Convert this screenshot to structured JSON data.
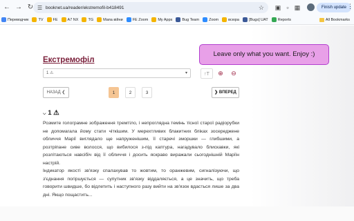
{
  "browser": {
    "url": "booknet.ua/reader/ekstremofil-b418491",
    "finish_update": "Finish update",
    "all_bookmarks": "All Bookmarks",
    "bookmarks": [
      {
        "label": "Переводчик",
        "color": "#4285f4"
      },
      {
        "label": "TV",
        "color": "#f4b400"
      },
      {
        "label": "FE",
        "color": "#f4b400"
      },
      {
        "label": "A7 NX",
        "color": "#f4b400"
      },
      {
        "label": "TG",
        "color": "#f4b400"
      },
      {
        "label": "Мапа війни",
        "color": "#f4b400"
      },
      {
        "label": "FE Zoom",
        "color": "#2d8cff"
      },
      {
        "label": "My Apps",
        "color": "#f4b400"
      },
      {
        "label": "Bug Team",
        "color": "#3b5998"
      },
      {
        "label": "Zoom",
        "color": "#2d8cff"
      },
      {
        "label": "всюра",
        "color": "#f4b400"
      },
      {
        "label": "[Bugs] UAT",
        "color": "#3b5998"
      },
      {
        "label": "Reports",
        "color": "#34a853"
      }
    ]
  },
  "reader": {
    "book_title": "Екстремофіл",
    "chapter_select": "1 ⚠",
    "font_icon": "font-size-icon",
    "prev_label": "НАЗАД",
    "next_label": "ВПЕРЕД",
    "pages": [
      "1",
      "2",
      "3"
    ],
    "active_page": "1",
    "chapter_heading": "1 ⚠",
    "paragraphs": [
      "Розмите голограмне зображення тремтіло, і непроглядна темінь тісної старої радіорубки не допомагала йому стати чіткішим. У мерехтливих блакитних бліках зосереджене обличчя Марії виглядало ще напруженішим, її старечі зморшки — глибшими, а розтріпане сиве волосся, що вибилося з-під каптура, нагадувало блискавки, які розлітаються навсібіч від її обличчя і досить яскраво виражали сьогоднішній Маріїн настрій.",
      "Індикатор якості зв'язку спалахував то жовтим, то оранжевим, сигналізуючи, що з'єднання погіршується — супутник зв'язку віддаляється, а це значить, що треба говорити швидше, бо відлетить і наступного разу вийти на зв'язок вдасться лише за два дні. Якщо пощастить..."
    ]
  },
  "popup": {
    "text": "Leave only what you want. Enjoy :)",
    "color": "#e8a0e8",
    "border": "#b23fcf"
  }
}
